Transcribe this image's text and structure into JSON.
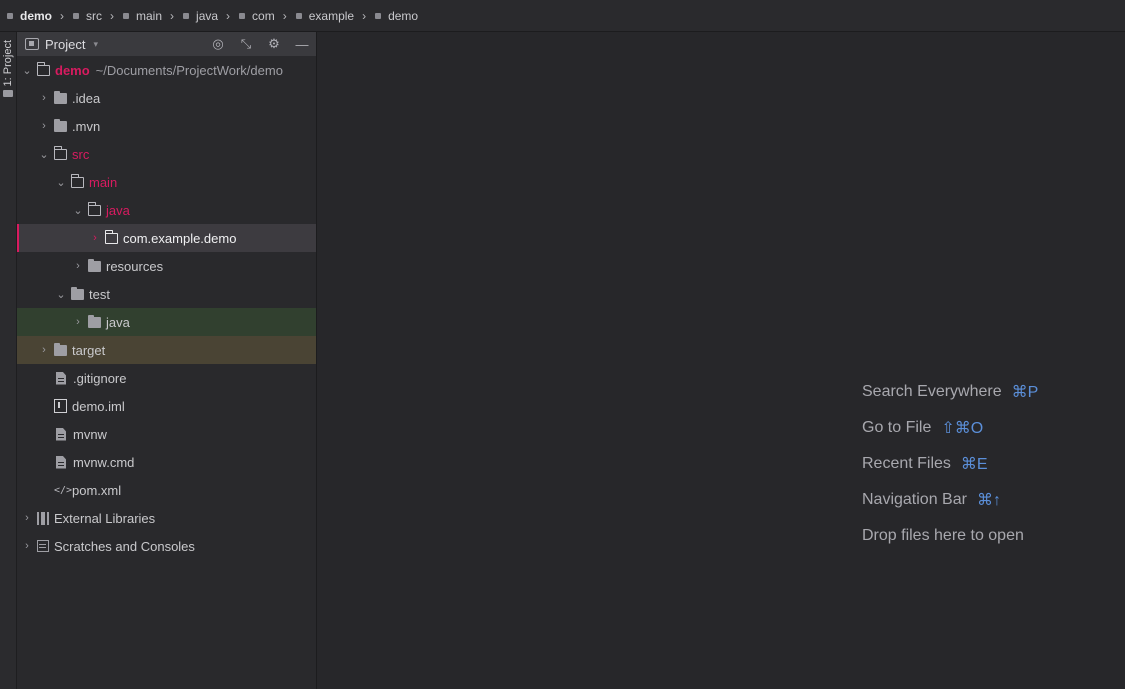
{
  "navbar": {
    "crumbs": [
      "demo",
      "src",
      "main",
      "java",
      "com",
      "example",
      "demo"
    ]
  },
  "stripe": {
    "label": "1: Project"
  },
  "panel": {
    "title": "Project",
    "tools": {
      "locate": "locate-icon",
      "collapse": "collapse-all-icon",
      "settings": "gear-icon",
      "hide": "minimize-icon"
    }
  },
  "tree": {
    "root": {
      "name": "demo",
      "path": "~/Documents/ProjectWork/demo"
    },
    "idea": ".idea",
    "mvn": ".mvn",
    "src": "src",
    "main": "main",
    "java_main": "java",
    "package": "com.example.demo",
    "resources": "resources",
    "test": "test",
    "java_test": "java",
    "target": "target",
    "gitignore": ".gitignore",
    "demo_iml": "demo.iml",
    "mvnw": "mvnw",
    "mvnw_cmd": "mvnw.cmd",
    "pom": "pom.xml",
    "external_libraries": "External Libraries",
    "scratches": "Scratches and Consoles"
  },
  "editor": {
    "hints": [
      {
        "text": "Search Everywhere",
        "key": "⌘P"
      },
      {
        "text": "Go to File",
        "key": "⇧⌘O"
      },
      {
        "text": "Recent Files",
        "key": "⌘E"
      },
      {
        "text": "Navigation Bar",
        "key": "⌘↑"
      },
      {
        "text": "Drop files here to open",
        "key": ""
      }
    ]
  },
  "colors": {
    "accent_red": "#d81b60",
    "shortcut_blue": "#5b8fd9",
    "test_bg": "#31402f",
    "excluded_bg": "#4a4434"
  }
}
